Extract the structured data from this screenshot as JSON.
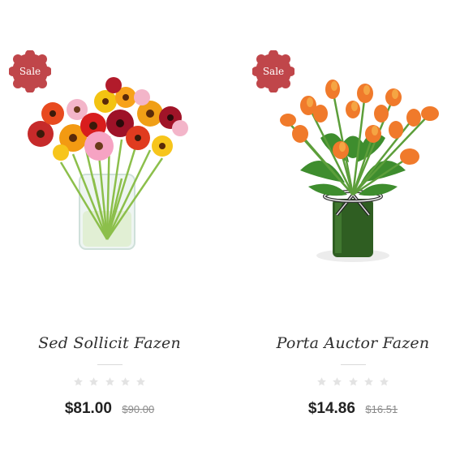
{
  "products": [
    {
      "badge": "Sale",
      "title": "Sed Sollicit Fazen",
      "price": "$81.00",
      "old_price": "$90.00",
      "rating_stars": 5,
      "rating_value": 0,
      "image_icon": "gerbera-bouquet-image"
    },
    {
      "badge": "Sale",
      "title": "Porta Auctor Fazen",
      "price": "$14.86",
      "old_price": "$16.51",
      "rating_stars": 5,
      "rating_value": 0,
      "image_icon": "tulip-bouquet-image"
    }
  ],
  "colors": {
    "badge": "#c0464a",
    "star_empty": "#e3e3e3",
    "title": "#2f2f2f",
    "price": "#222222",
    "old_price": "#8a8a8a"
  }
}
